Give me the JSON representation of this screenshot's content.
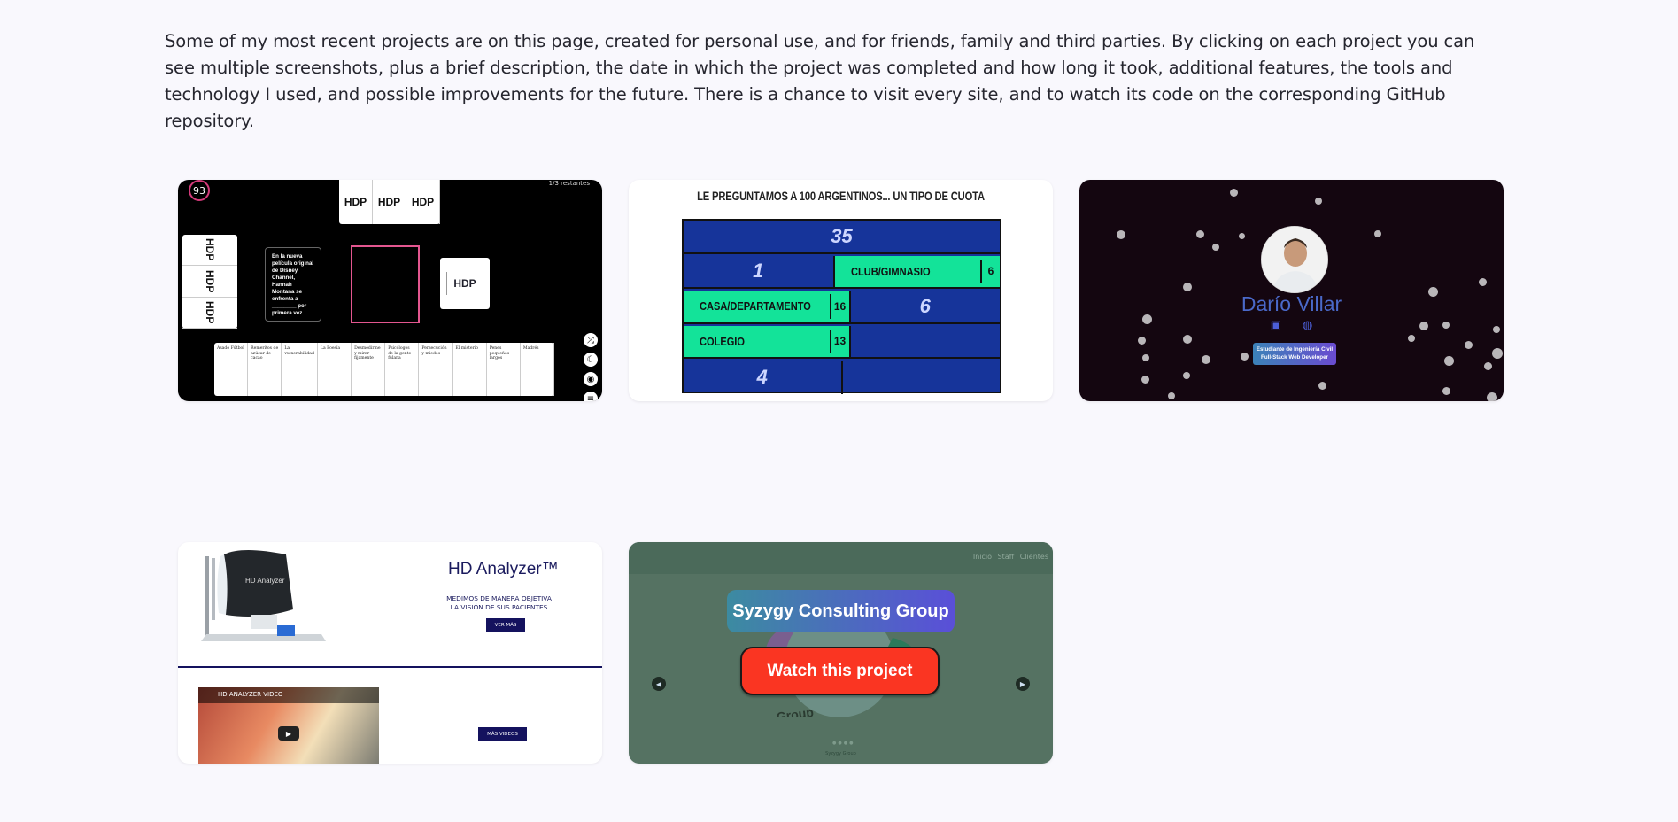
{
  "intro": "Some of my most recent projects are on this page, created for personal use, and for friends, family and third parties. By clicking on each project you can see multiple screenshots, plus a brief description, the date in which the project was completed and how long it took, additional features, the tools and technology I used, and possible improvements for the future. There is a chance to visit every site, and to watch its code on the corresponding GitHub repository.",
  "game": {
    "counter": "93",
    "remaining": "1/3 restantes",
    "card_label": "HDP",
    "black_card": "En la nueva película original de Disney Channel, Hannah Montana se enfrenta a ________ por primera vez.",
    "categories": [
      "Asado Fútbol",
      "Remeritos de azúcar de cacao",
      "La vulnerabilidad",
      "La Poesía",
      "Desmedirme y mirar fijamente",
      "Psicólogos de la gente fulana",
      "Persecución y miedos",
      "El misterio",
      "Penes pequeños largos",
      "Madrés"
    ],
    "icons": [
      "shuffle-icon",
      "moon-icon",
      "camera-icon",
      "menu-icon"
    ]
  },
  "quiz": {
    "title": "LE PREGUNTAMOS A 100 ARGENTINOS... UN TIPO DE CUOTA",
    "total": "35",
    "rows": [
      {
        "left": {
          "type": "num",
          "text": "1"
        },
        "right": {
          "type": "ans",
          "text": "CLUB/GIMNASIO",
          "pts": "6"
        }
      },
      {
        "left": {
          "type": "ans",
          "text": "CASA/DEPARTAMENTO",
          "pts": "16"
        },
        "right": {
          "type": "num",
          "text": "6"
        }
      },
      {
        "left": {
          "type": "ans",
          "text": "COLEGIO",
          "pts": "13"
        },
        "right": {
          "type": "num",
          "text": ""
        }
      },
      {
        "left": {
          "type": "num",
          "text": "4"
        },
        "right": {
          "type": "num",
          "text": ""
        }
      }
    ]
  },
  "portfolio": {
    "name": "Darío Villar",
    "badge_line1": "Estudiante de Ingeniería Civil",
    "badge_line2": "Full-Stack Web Developer",
    "social_icons": [
      "linkedin-icon",
      "github-icon"
    ]
  },
  "analyzer": {
    "title": "HD Analyzer™",
    "subtitle_line1": "MEDIMOS DE MANERA OBJETIVA",
    "subtitle_line2": "LA VISIÓN DE SUS PACIENTES",
    "btn_more": "VER MÁS",
    "video_title": "HD ANALYZER VIDEO",
    "btn_videos": "MÁS VIDEOS"
  },
  "syzygy": {
    "nav": "Inicio Staff Clientes",
    "logo_text": "Group",
    "title": "Syzygy Consulting Group",
    "watch": "Watch this project",
    "footer": "Syzygy Group"
  },
  "colors": {
    "background": "#f9f8fd",
    "quiz_blue": "#16349a",
    "quiz_green": "#13e399",
    "watch_red": "#fa3522",
    "portfolio_name": "#4a69c9",
    "analyzer_navy": "#14125e"
  }
}
